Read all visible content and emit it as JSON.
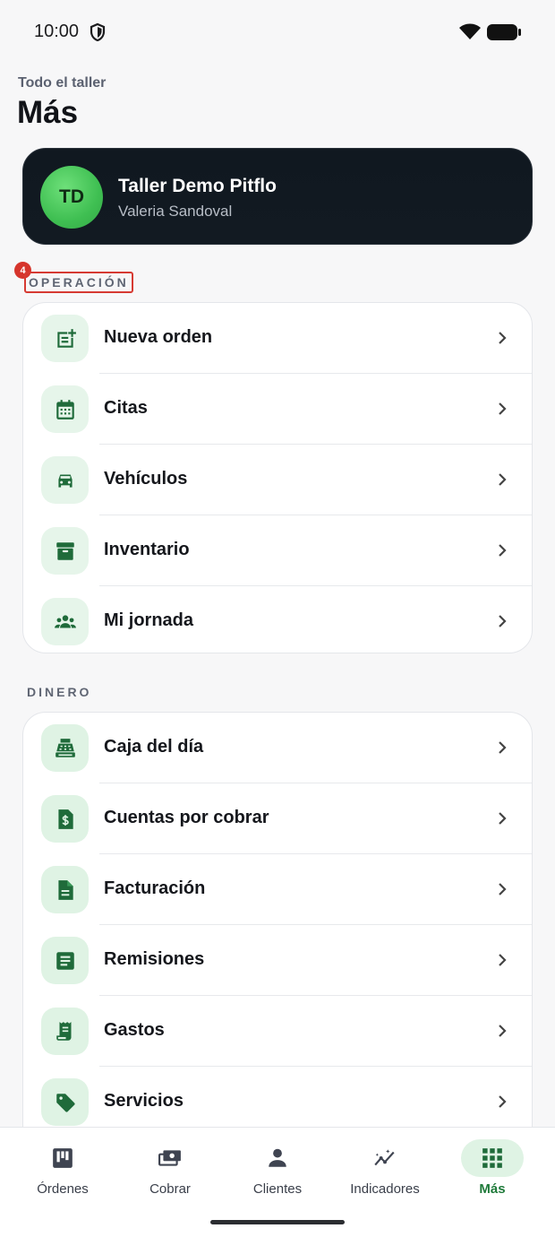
{
  "status": {
    "time": "10:00"
  },
  "header": {
    "subtitle": "Todo el taller",
    "title": "Más"
  },
  "profile": {
    "initials": "TD",
    "name": "Taller Demo Pitflo",
    "user": "Valeria Sandoval"
  },
  "sections": {
    "operacion": {
      "label": "OPERACIÓN",
      "badge": "4",
      "items": [
        {
          "label": "Nueva orden",
          "icon": "note-add-icon"
        },
        {
          "label": "Citas",
          "icon": "calendar-icon"
        },
        {
          "label": "Vehículos",
          "icon": "car-icon"
        },
        {
          "label": "Inventario",
          "icon": "archive-box-icon"
        },
        {
          "label": "Mi jornada",
          "icon": "group-icon"
        }
      ]
    },
    "dinero": {
      "label": "DINERO",
      "items": [
        {
          "label": "Caja del día",
          "icon": "cash-register-icon"
        },
        {
          "label": "Cuentas por cobrar",
          "icon": "invoice-dollar-icon"
        },
        {
          "label": "Facturación",
          "icon": "document-icon"
        },
        {
          "label": "Remisiones",
          "icon": "receipt-list-icon"
        },
        {
          "label": "Gastos",
          "icon": "receipt-icon"
        },
        {
          "label": "Servicios",
          "icon": "tag-icon"
        }
      ]
    }
  },
  "nav": [
    {
      "label": "Órdenes",
      "icon": "kanban-icon"
    },
    {
      "label": "Cobrar",
      "icon": "payments-icon"
    },
    {
      "label": "Clientes",
      "icon": "person-icon"
    },
    {
      "label": "Indicadores",
      "icon": "insights-icon"
    },
    {
      "label": "Más",
      "icon": "apps-grid-icon"
    }
  ],
  "colors": {
    "accent": "#1f7a3a",
    "icon_bg": "#e6f5ea",
    "card_dark": "#101820",
    "badge": "#d6352c"
  }
}
